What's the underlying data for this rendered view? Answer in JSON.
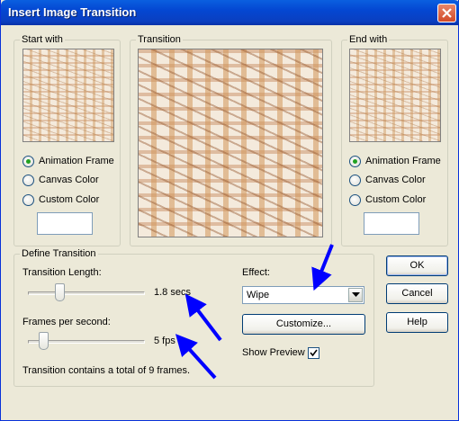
{
  "window": {
    "title": "Insert Image Transition"
  },
  "start_with": {
    "legend": "Start with",
    "options": [
      "Animation Frame",
      "Canvas Color",
      "Custom Color"
    ],
    "selected": "Animation Frame"
  },
  "transition": {
    "legend": "Transition"
  },
  "end_with": {
    "legend": "End with",
    "options": [
      "Animation Frame",
      "Canvas Color",
      "Custom Color"
    ],
    "selected": "Animation Frame"
  },
  "define": {
    "legend": "Define Transition",
    "length_label": "Transition Length:",
    "length_value": "1.8 secs",
    "length_slider_fraction": 0.25,
    "fps_label": "Frames per second:",
    "fps_value": "5 fps",
    "fps_slider_fraction": 0.1,
    "frames_note": "Transition contains a total of 9 frames.",
    "effect_label": "Effect:",
    "effect_value": "Wipe",
    "customize_label": "Customize...",
    "show_preview_label": "Show Preview",
    "show_preview_checked": true
  },
  "buttons": {
    "ok": "OK",
    "cancel": "Cancel",
    "help": "Help"
  },
  "colors": {
    "titlebar": "#0A5FE0",
    "dialog_bg": "#ECE9D8",
    "annotation_arrow": "#0000FF"
  }
}
